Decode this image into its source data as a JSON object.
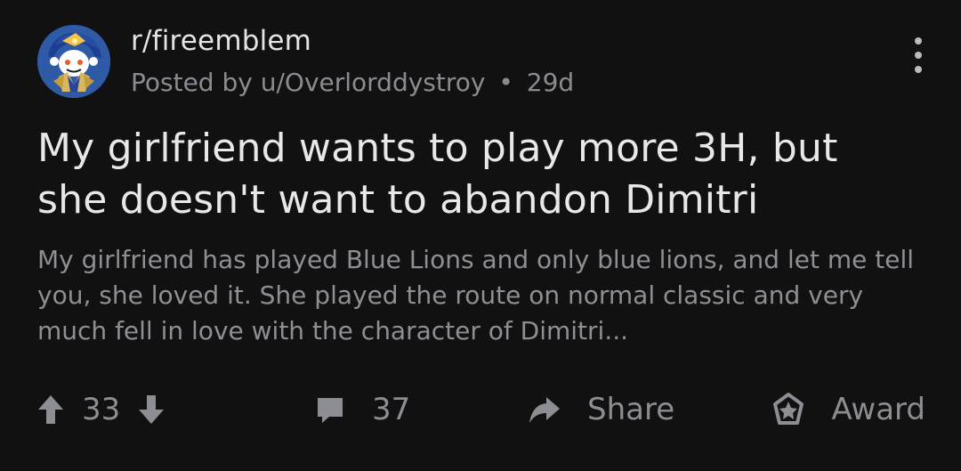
{
  "post": {
    "subreddit": "r/fireemblem",
    "posted_by_label": "Posted by u/Overlorddystroy",
    "separator": "•",
    "age": "29d",
    "title": "My girlfriend wants to play more 3H, but she doesn't want to abandon Dimitri",
    "body": "My girlfriend has played Blue Lions and only blue lions,  and let me tell you, she loved it. She played the route on normal classic and very much fell in love with the character of Dimitri..."
  },
  "actions": {
    "upvote_icon": "arrow-up-icon",
    "score": "33",
    "downvote_icon": "arrow-down-icon",
    "comment_icon": "comment-icon",
    "comments": "37",
    "share_icon": "share-icon",
    "share_label": "Share",
    "award_icon": "award-icon",
    "award_label": "Award"
  },
  "colors": {
    "background": "#111112",
    "title_text": "#e8e8ea",
    "secondary_text": "#8d8e93",
    "avatar_blue": "#2f5aa6"
  }
}
